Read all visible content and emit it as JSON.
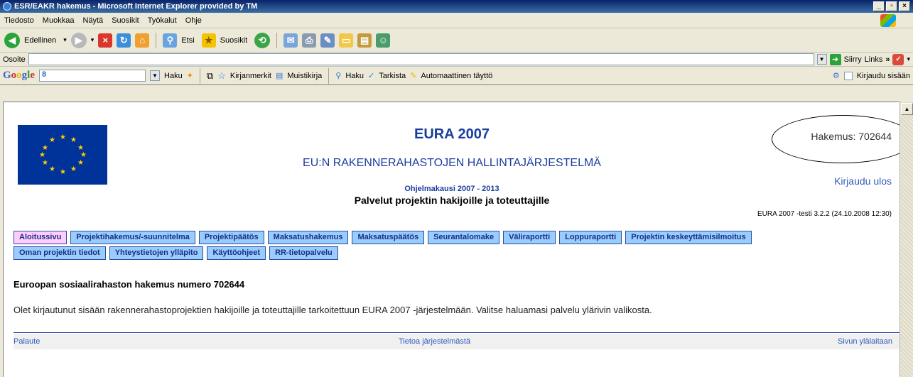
{
  "window": {
    "title": "ESR/EAKR hakemus - Microsoft Internet Explorer provided by TM",
    "controls": [
      "_",
      "▫",
      "×"
    ]
  },
  "menubar": [
    "Tiedosto",
    "Muokkaa",
    "Näytä",
    "Suosikit",
    "Työkalut",
    "Ohje"
  ],
  "toolbar": {
    "back": "Edellinen",
    "search": "Etsi",
    "favorites": "Suosikit"
  },
  "addressbar": {
    "label": "Osoite",
    "value": "",
    "go": "Siirry",
    "links": "Links"
  },
  "googlebar": {
    "logo": "Google",
    "g8": "8",
    "search": "Haku",
    "bookmarks": "Kirjanmerkit",
    "notebook": "Muistikirja",
    "find": "Haku",
    "check": "Tarkista",
    "autofill": "Automaattinen täyttö",
    "signin": "Kirjaudu sisään"
  },
  "page": {
    "title": "EURA 2007",
    "subtitle": "EU:N RAKENNERAHASTOJEN HALLINTAJÄRJESTELMÄ",
    "program_period": "Ohjelmakausi 2007 - 2013",
    "services": "Palvelut projektin hakijoille ja toteuttajille",
    "application": "Hakemus: 702644",
    "logout": "Kirjaudu ulos",
    "version": "EURA 2007 -testi 3.2.2 (24.10.2008 12:30)",
    "heading": "Euroopan sosiaalirahaston hakemus numero 702644",
    "intro": "Olet kirjautunut sisään rakennerahastoprojektien hakijoille ja toteuttajille tarkoitettuun EURA 2007 -järjestelmään. Valitse haluamasi palvelu ylärivin valikosta."
  },
  "nav_row1": [
    "Aloitussivu",
    "Projektihakemus/-suunnitelma",
    "Projektipäätös",
    "Maksatushakemus",
    "Maksatuspäätös",
    "Seurantalomake",
    "Väliraportti",
    "Loppuraportti",
    "Projektin keskeyttämisilmoitus"
  ],
  "nav_row2": [
    "Oman projektin tiedot",
    "Yhteystietojen ylläpito",
    "Käyttöohjeet",
    "RR-tietopalvelu"
  ],
  "footer": {
    "feedback": "Palaute",
    "about": "Tietoa järjestelmästä",
    "top": "Sivun ylälaitaan"
  },
  "colors": {
    "nav_bg": "#99ccff",
    "nav_active_bg": "#ffccff",
    "title_blue": "#1a3e9e",
    "eu_flag": "#003399"
  }
}
